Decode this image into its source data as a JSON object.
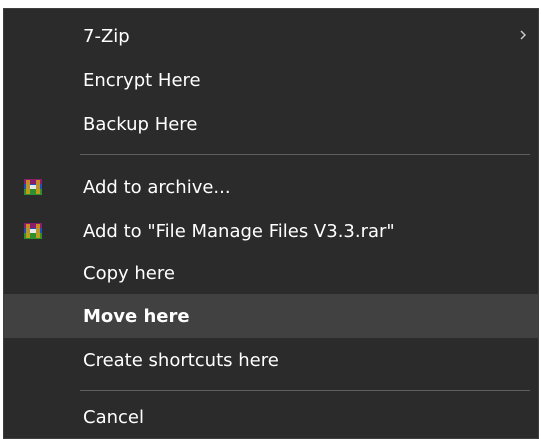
{
  "menu": {
    "items": [
      {
        "label": "7-Zip",
        "submenu": true
      },
      {
        "label": "Encrypt Here"
      },
      {
        "label": "Backup Here"
      },
      {
        "label": "Add to archive...",
        "icon": "winrar-archive-icon"
      },
      {
        "label": "Add to \"File Manage Files V3.3.rar\"",
        "icon": "winrar-archive-icon"
      },
      {
        "label": "Copy here"
      },
      {
        "label": "Move here",
        "highlighted": true,
        "bold": true
      },
      {
        "label": "Create shortcuts here"
      },
      {
        "label": "Cancel"
      }
    ]
  },
  "colors": {
    "menu_background": "#2b2b2b",
    "highlight": "#414141",
    "separator": "#5e5e5e",
    "text": "#ffffff"
  }
}
